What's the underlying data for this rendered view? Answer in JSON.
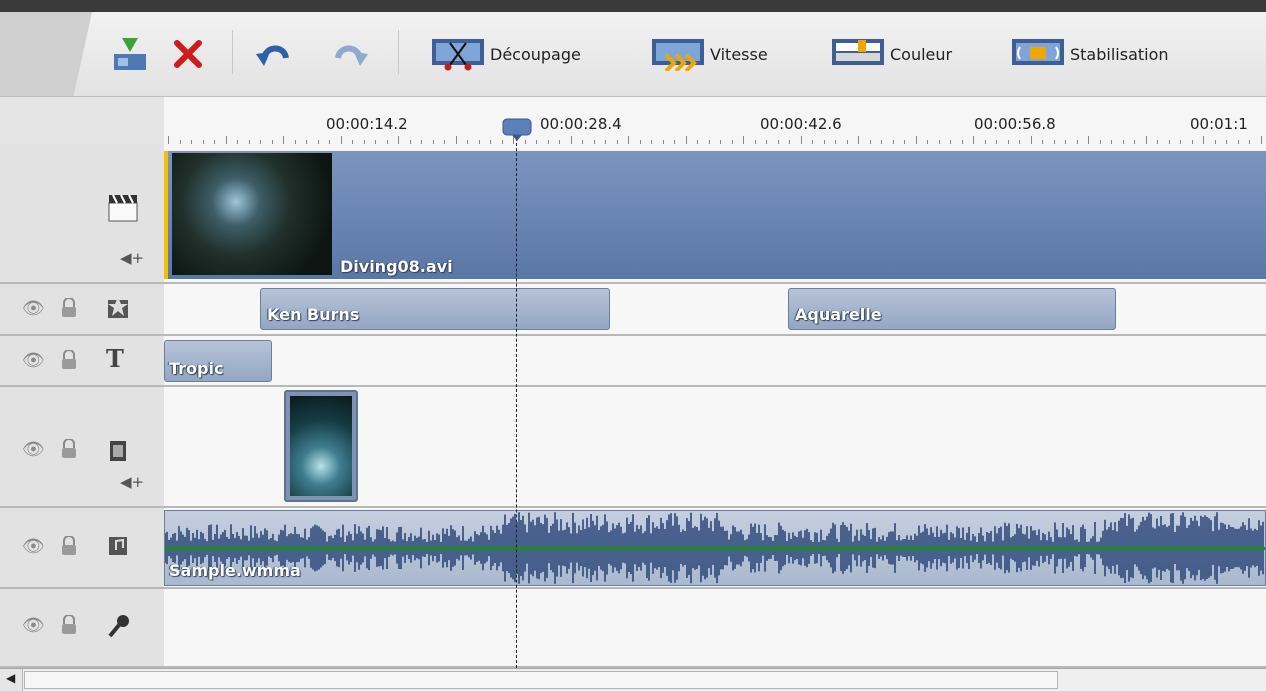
{
  "toolbar": {
    "cut_label": "Découpage",
    "speed_label": "Vitesse",
    "color_label": "Couleur",
    "stabilize_label": "Stabilisation"
  },
  "ruler": {
    "marks": [
      "00:00:14.2",
      "00:00:28.4",
      "00:00:42.6",
      "00:00:56.8",
      "00:01:1"
    ]
  },
  "tracks": {
    "video": {
      "clip_name": "Diving08.avi"
    },
    "effects": {
      "clips": [
        "Ken Burns",
        "Aquarelle"
      ]
    },
    "text": {
      "clip_name": "Tropic"
    },
    "audio": {
      "clip_name": "Sample.wmma"
    }
  },
  "colors": {
    "clip_blue": "#5977a6",
    "playhead": "#5b7fb9",
    "audio_line": "#1a8a1a",
    "marker_yellow": "#f2c200"
  }
}
